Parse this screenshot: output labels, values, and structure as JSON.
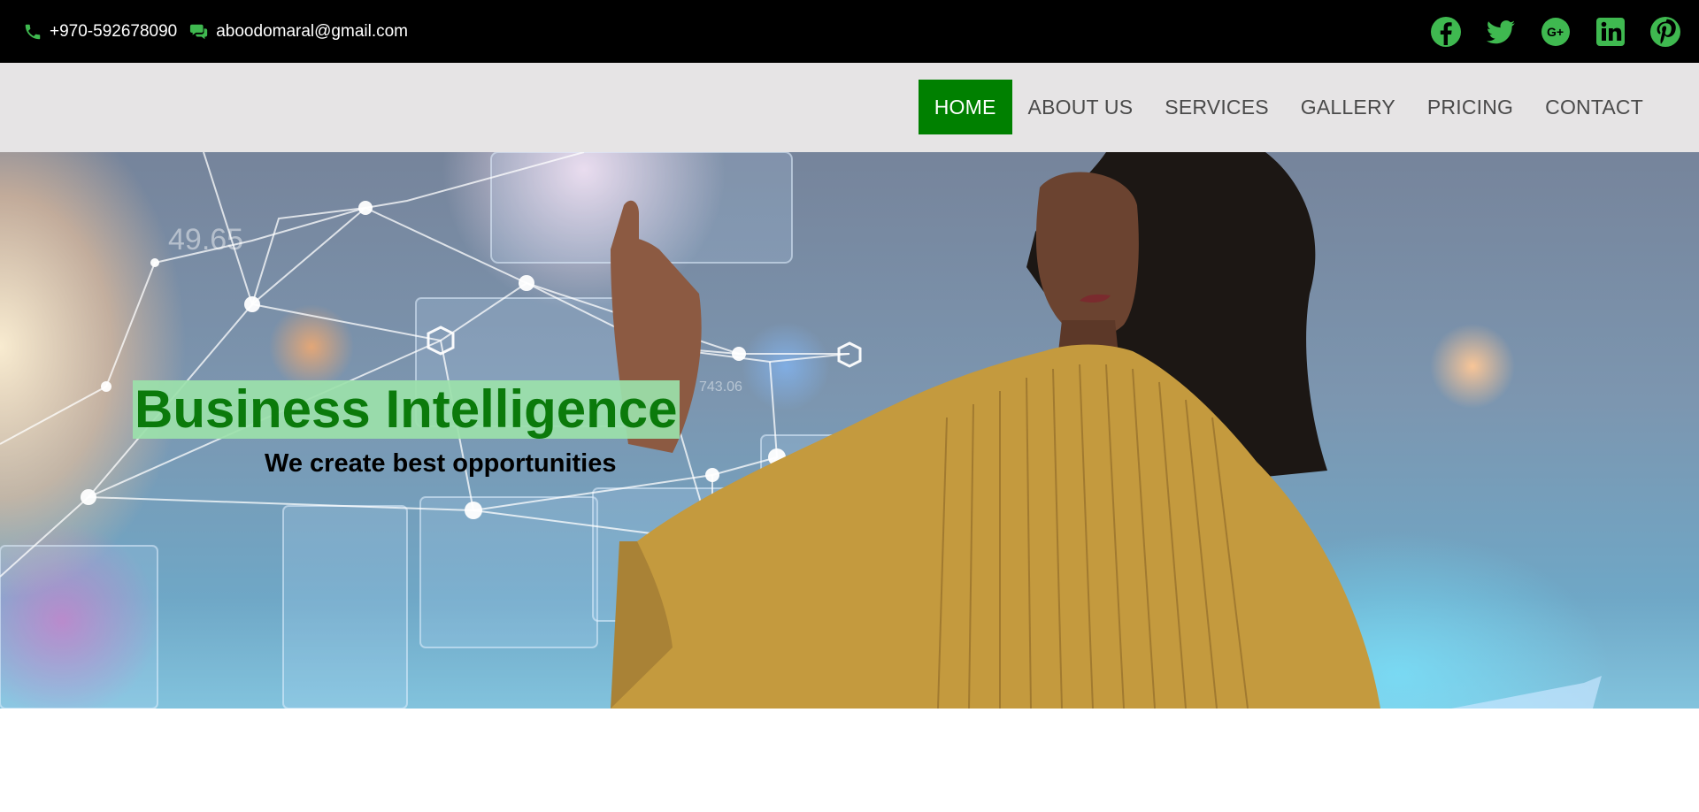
{
  "topbar": {
    "phone": {
      "icon": "phone-icon",
      "text": "+970-592678090"
    },
    "email": {
      "icon": "chat-icon",
      "text": "aboodomaral@gmail.com"
    },
    "socials": [
      "facebook-icon",
      "twitter-icon",
      "google-plus-icon",
      "linkedin-icon",
      "pinterest-icon"
    ],
    "accent_color": "#3fb950"
  },
  "nav": {
    "items": [
      {
        "label": "HOME",
        "active": true
      },
      {
        "label": "ABOUT US",
        "active": false
      },
      {
        "label": "SERVICES",
        "active": false
      },
      {
        "label": "GALLERY",
        "active": false
      },
      {
        "label": "PRICING",
        "active": false
      },
      {
        "label": "CONTACT",
        "active": false
      }
    ],
    "active_color": "#008000",
    "background": "#e6e4e5"
  },
  "hero": {
    "title": "Business Intelligence",
    "subtitle": "We create best opportunities"
  }
}
